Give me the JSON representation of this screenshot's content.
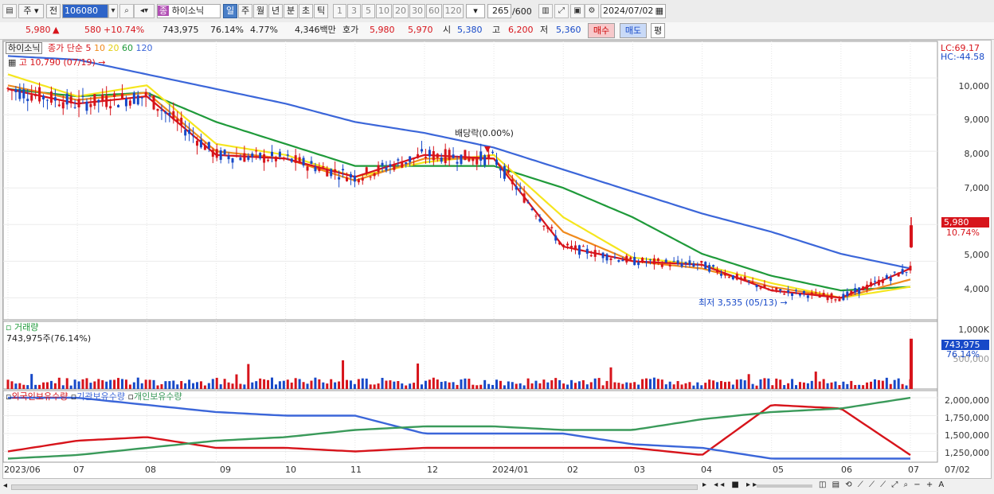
{
  "toolbar": {
    "type_label": "주",
    "prev_label": "전",
    "code": "106080",
    "stock_name": "하이소닉",
    "stock_badge": "종",
    "periods": [
      "일",
      "주",
      "월",
      "년",
      "분",
      "초",
      "틱"
    ],
    "selected_period": "일",
    "minute_options": [
      "1",
      "3",
      "5",
      "10",
      "20",
      "30",
      "60",
      "120"
    ],
    "count": "265",
    "count_total": "/600",
    "date": "2024/07/02"
  },
  "quote": {
    "price": "5,980",
    "arrow": "▲",
    "change": "580",
    "change_pct": "+10.74%",
    "volume": "743,975",
    "vol_ratio": "76.14%",
    "turnover": "4.77%",
    "amount": "4,346백만",
    "bid_label": "호가",
    "ask": "5,980",
    "bid": "5,970",
    "open_label": "시",
    "open": "5,380",
    "high_label": "고",
    "high": "6,200",
    "low_label": "저",
    "low": "5,360",
    "buy_label": "매수",
    "sell_label": "매도",
    "eval_label": "평"
  },
  "price_panel": {
    "title": "하이소닉",
    "ma_label": "종가 단순",
    "ma_periods": [
      "5",
      "10",
      "20",
      "60",
      "120"
    ],
    "high_note": "고 10,790 (07/19)",
    "low_note": "최저 3,535 (05/13)",
    "event_note": "배당락(0.00%)",
    "lc": "LC:69.17",
    "hc": "HC:-44.58",
    "last_price": "5,980",
    "last_pct": "10.74%",
    "y_ticks": [
      "10,000",
      "9,000",
      "8,000",
      "7,000",
      "6,000",
      "5,000",
      "4,000"
    ]
  },
  "volume_panel": {
    "title": "거래량",
    "info": "743,975주(76.14%)",
    "top_tick": "1,000K",
    "mid_tick": "500,000",
    "last_value": "743,975",
    "last_pct": "76.14%"
  },
  "holding_panel": {
    "series_names": [
      "외국인보유수량",
      "기관보유수량",
      "개인보유수량"
    ],
    "y_ticks": [
      "2,000,000",
      "1,750,000",
      "1,500,000",
      "1,250,000"
    ]
  },
  "x_axis": [
    "2023/06",
    "07",
    "08",
    "09",
    "10",
    "11",
    "12",
    "2024/01",
    "02",
    "03",
    "04",
    "05",
    "06",
    "07"
  ],
  "x_right_label": "07/02",
  "colors": {
    "ma5": "#d7141b",
    "ma10": "#f08a1c",
    "ma20": "#f5e61e",
    "ma60": "#1f9a3a",
    "ma120": "#3b66d9",
    "up": "#d7141b",
    "down": "#1749c8",
    "foreign": "#d7141b",
    "institution": "#3b66d9",
    "individual": "#3a9a5a"
  },
  "chart_data": {
    "type": "line",
    "x": [
      "2023/06",
      "07",
      "08",
      "09",
      "10",
      "11",
      "12",
      "2024/01",
      "02",
      "03",
      "04",
      "05",
      "06",
      "07"
    ],
    "series": [
      {
        "name": "종가 단순 5",
        "values": [
          9700,
          9300,
          9500,
          7900,
          7800,
          7300,
          7900,
          7800,
          5400,
          5000,
          4900,
          4200,
          4000,
          4800
        ]
      },
      {
        "name": "종가 단순 10",
        "values": [
          9800,
          9400,
          9600,
          8000,
          7800,
          7200,
          7800,
          7800,
          5800,
          5000,
          4800,
          4300,
          4000,
          4500
        ]
      },
      {
        "name": "종가 단순 20",
        "values": [
          10100,
          9500,
          9800,
          8200,
          7900,
          7300,
          7700,
          7900,
          6200,
          5100,
          4900,
          4400,
          4000,
          4300
        ]
      },
      {
        "name": "종가 단순 60",
        "values": [
          9700,
          9500,
          9600,
          8800,
          8200,
          7600,
          7600,
          7600,
          7000,
          6200,
          5200,
          4600,
          4200,
          4300
        ]
      },
      {
        "name": "종가 단순 120",
        "values": [
          10600,
          10500,
          10100,
          9700,
          9300,
          8800,
          8500,
          8100,
          7500,
          6900,
          6300,
          5800,
          5200,
          4800
        ]
      },
      {
        "name": "외국인보유수량",
        "values": [
          1250000,
          1400000,
          1450000,
          1300000,
          1300000,
          1250000,
          1300000,
          1300000,
          1300000,
          1300000,
          1200000,
          1900000,
          1850000,
          1200000
        ]
      },
      {
        "name": "기관보유수량",
        "values": [
          2000000,
          2000000,
          1900000,
          1800000,
          1750000,
          1750000,
          1500000,
          1500000,
          1500000,
          1350000,
          1300000,
          1150000,
          1150000,
          1150000
        ]
      },
      {
        "name": "개인보유수량",
        "values": [
          1150000,
          1200000,
          1300000,
          1400000,
          1450000,
          1550000,
          1600000,
          1600000,
          1550000,
          1550000,
          1700000,
          1800000,
          1850000,
          2000000
        ]
      }
    ],
    "price_ylim": [
      3400,
      11000
    ],
    "holding_ylim": [
      1100000,
      2100000
    ],
    "high": {
      "value": 10790,
      "date": "07/19"
    },
    "low": {
      "value": 3535,
      "date": "05/13"
    },
    "last": 5980,
    "last_change_pct": 10.74,
    "last_volume": 743975,
    "volume_ylim": [
      0,
      1000000
    ],
    "grid": true,
    "legend": "top-left"
  }
}
